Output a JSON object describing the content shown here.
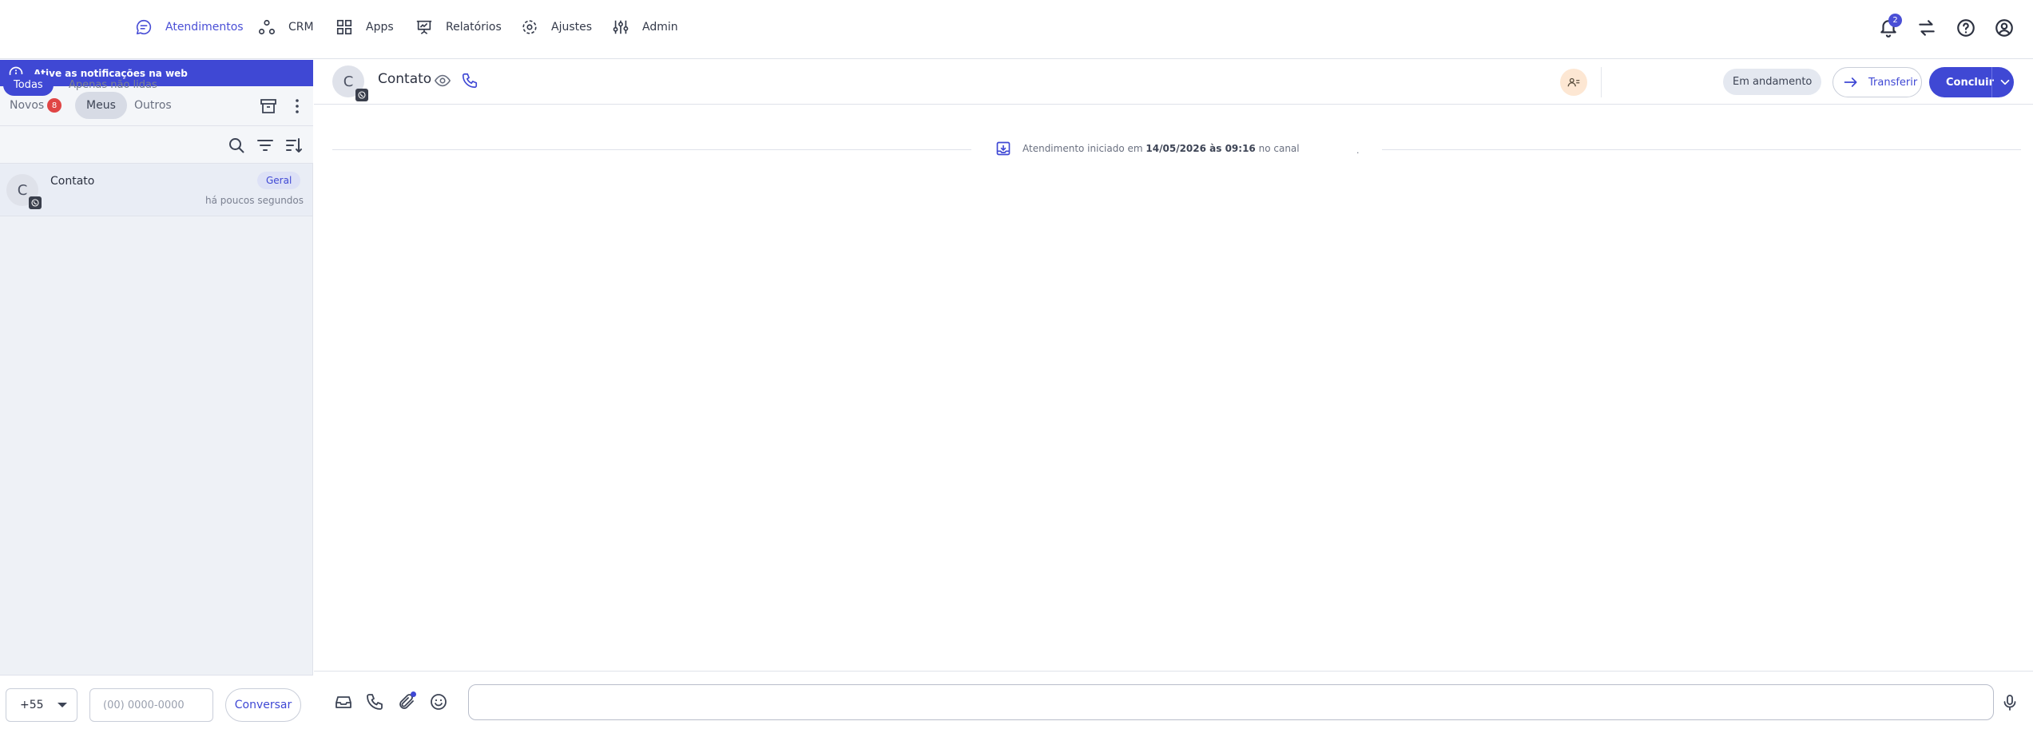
{
  "nav": {
    "items": [
      {
        "label": "Atendimentos",
        "icon": "chat-bubble-icon",
        "active": true
      },
      {
        "label": "CRM",
        "icon": "crm-nodes-icon"
      },
      {
        "label": "Apps",
        "icon": "apps-grid-icon"
      },
      {
        "label": "Relatórios",
        "icon": "presentation-chart-icon"
      },
      {
        "label": "Ajustes",
        "icon": "gear-icon"
      },
      {
        "label": "Admin",
        "icon": "sliders-icon"
      }
    ],
    "notifications_count": "2",
    "right_icons": [
      "bell-icon",
      "swap-arrows-icon",
      "help-circle-icon",
      "user-circle-icon"
    ]
  },
  "sidebar": {
    "banner": "Ative as notificações na web",
    "tabs": [
      {
        "label": "Novos",
        "count": "8"
      },
      {
        "label": "Meus",
        "selected": true
      },
      {
        "label": "Outros"
      }
    ],
    "filters": {
      "all": "Todas",
      "unread": "Apenas não lidas"
    },
    "conversations": [
      {
        "avatar": "C",
        "name": "Contato",
        "tag": "Geral",
        "time": "há poucos segundos",
        "channel": "whatsapp"
      }
    ],
    "new_conversation": {
      "country_code": "+55",
      "phone_placeholder": "(00) 0000-0000",
      "button": "Conversar"
    }
  },
  "chat": {
    "contact_avatar": "C",
    "contact_name": "Contato",
    "status": "Em andamento",
    "transfer_label": "Transferir",
    "conclude_label": "Concluir",
    "system_message": {
      "prefix": "Atendimento iniciado em",
      "datetime": "14/05/2026 às 09:16",
      "suffix": "no canal",
      "trailing": "."
    }
  },
  "colors": {
    "accent": "#3f48d4",
    "badge_red": "#e04545",
    "sidebar_bg": "#eef1f6"
  }
}
